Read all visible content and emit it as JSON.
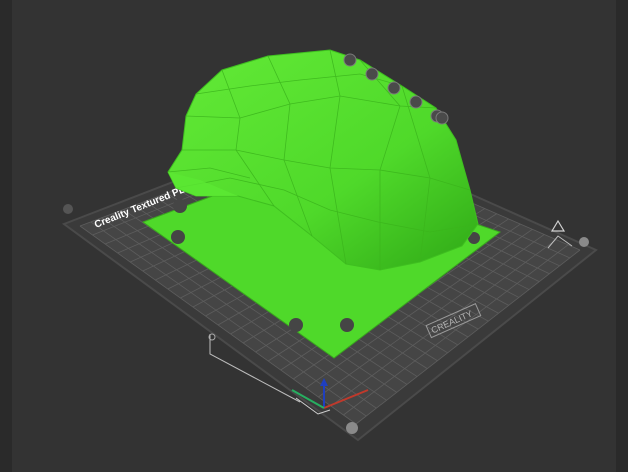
{
  "bed": {
    "label": "Creality Textured PEI Plate",
    "logo": "CREALITY"
  },
  "model": {
    "color": "#4fd92a"
  },
  "scene": {
    "background": "#262626",
    "bed_color": "#3b3b3b",
    "grid_color": "#5a5a5a"
  },
  "view_controls": {
    "icons": [
      "arrange-icon",
      "orient-icon",
      "lay-flat-icon",
      "auto-fit-icon",
      "layer-icon",
      "settings-gear-icon"
    ]
  },
  "axes": {
    "x_color": "#c0392b",
    "y_color": "#27ae60",
    "z_color": "#1f3fbf"
  }
}
